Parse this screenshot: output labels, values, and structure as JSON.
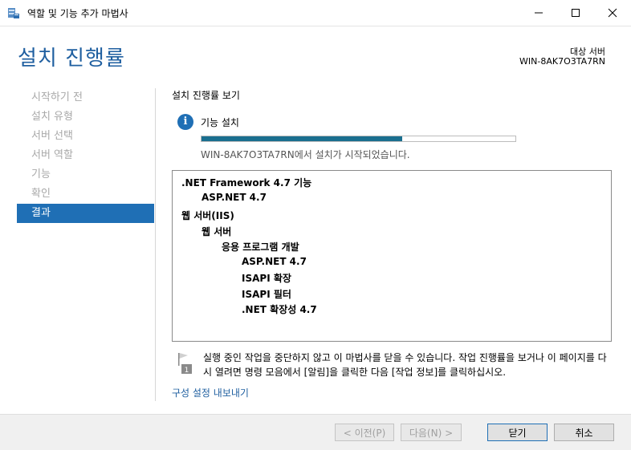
{
  "window": {
    "title": "역할 및 기능 추가 마법사"
  },
  "header": {
    "title": "설치 진행률",
    "target_label": "대상 서버",
    "target_name": "WIN-8AK7O3TA7RN"
  },
  "nav": {
    "items": [
      {
        "label": "시작하기 전"
      },
      {
        "label": "설치 유형"
      },
      {
        "label": "서버 선택"
      },
      {
        "label": "서버 역할"
      },
      {
        "label": "기능"
      },
      {
        "label": "확인"
      },
      {
        "label": "결과"
      }
    ],
    "active_index": 6
  },
  "main": {
    "section_label": "설치 진행률 보기",
    "progress_title": "기능 설치",
    "progress_fraction": 0.64,
    "status": "WIN-8AK7O3TA7RN에서 설치가 시작되었습니다.",
    "results": [
      {
        "text": ".NET Framework 4.7 기능",
        "level": 0
      },
      {
        "text": "ASP.NET 4.7",
        "level": 1
      },
      {
        "text": "웹 서버(IIS)",
        "level": 0
      },
      {
        "text": "웹 서버",
        "level": 1
      },
      {
        "text": "응용 프로그램 개발",
        "level": 2
      },
      {
        "text": "ASP.NET 4.7",
        "level": 3
      },
      {
        "text": "ISAPI 확장",
        "level": 3
      },
      {
        "text": "ISAPI 필터",
        "level": 3
      },
      {
        "text": ".NET 확장성 4.7",
        "level": 3
      }
    ],
    "note": "실행 중인 작업을 중단하지 않고 이 마법사를 닫을 수 있습니다. 작업 진행률을 보거나 이 페이지를 다시 열려면 명령 모음에서 [알림]을 클릭한 다음 [작업 정보]를 클릭하십시오.",
    "note_badge": "1",
    "export_link": "구성 설정 내보내기"
  },
  "footer": {
    "prev": "< 이전(P)",
    "next": "다음(N) >",
    "close": "닫기",
    "cancel": "취소"
  },
  "colors": {
    "accent": "#1f6fb5",
    "progress": "#1a6f8f",
    "title": "#1f5fa0"
  },
  "icons": {
    "app": "server-manager-icon",
    "info": "info-icon",
    "note": "flag-icon"
  }
}
